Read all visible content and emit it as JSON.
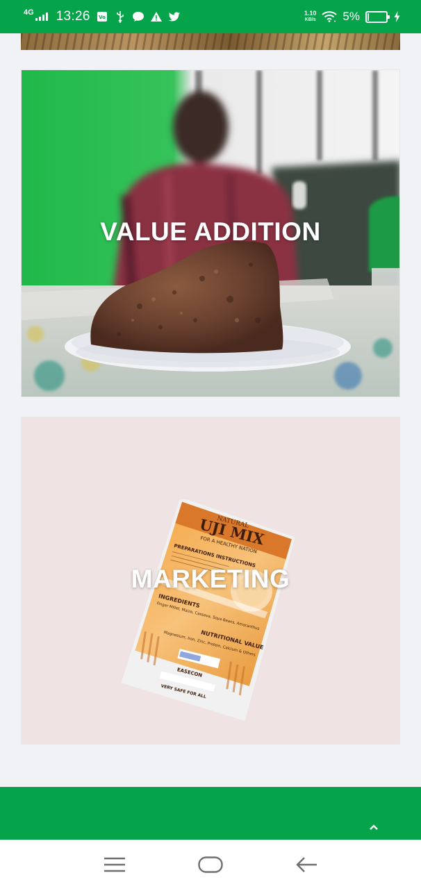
{
  "status_bar": {
    "network": "4G",
    "time": "13:26",
    "speed_top": "1.10",
    "speed_bottom": "KB/s",
    "battery_pct": "5%"
  },
  "cards": [
    {
      "title": "VALUE ADDITION"
    },
    {
      "title": "MARKETING"
    }
  ],
  "product": {
    "brand_top": "NATURAL",
    "name": "UJI MIX",
    "tagline": "FOR A HEALTHY NATION",
    "instructions_heading": "PREPARATIONS INSTRUCTIONS",
    "ingredients_heading": "INGREDIENTS",
    "ingredients_text": "Finger Millet, Maize, Cassava, Soya Beans, Amaranthus",
    "nutrition_heading": "NUTRITIONAL VALUE",
    "nutrition_text": "Magnesium, Iron, Zinc, Protein, Calcium & Others",
    "manufacturer": "EASECON",
    "footer_text": "VERY SAFE FOR ALL"
  },
  "colors": {
    "brand_green": "#05a44a",
    "page_bg": "#f1f2f6"
  }
}
